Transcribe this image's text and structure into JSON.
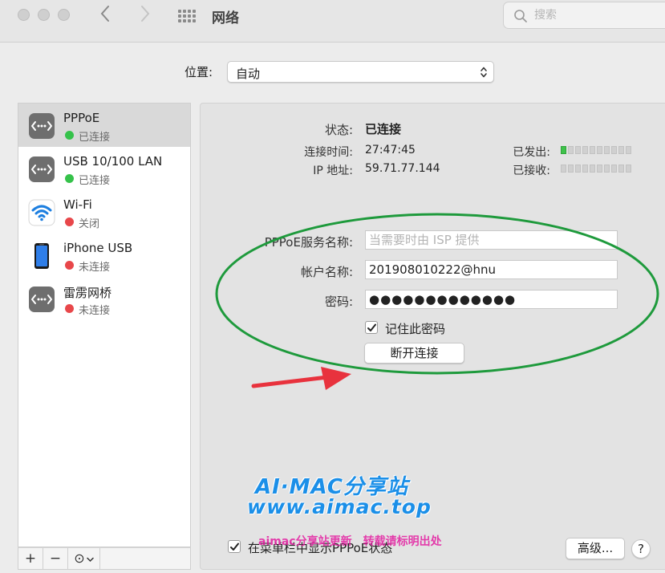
{
  "window": {
    "title": "网络",
    "search_placeholder": "搜索"
  },
  "location": {
    "label": "位置:",
    "value": "自动"
  },
  "sidebar": {
    "items": [
      {
        "name": "PPPoE",
        "status": "已连接",
        "status_color": "#35c24a",
        "icon": "connection-arrows-icon",
        "selected": true
      },
      {
        "name": "USB 10/100 LAN",
        "status": "已连接",
        "status_color": "#35c24a",
        "icon": "connection-arrows-icon",
        "selected": false
      },
      {
        "name": "Wi-Fi",
        "status": "关闭",
        "status_color": "#e8474a",
        "icon": "wifi-icon",
        "selected": false
      },
      {
        "name": "iPhone USB",
        "status": "未连接",
        "status_color": "#e8474a",
        "icon": "iphone-icon",
        "selected": false
      },
      {
        "name": "雷雳网桥",
        "status": "未连接",
        "status_color": "#e8474a",
        "icon": "connection-arrows-icon",
        "selected": false
      }
    ],
    "footer": {
      "add": "+",
      "remove": "−",
      "action": "⊙"
    }
  },
  "detail": {
    "status_label": "状态:",
    "status_value": "已连接",
    "conn_time_label": "连接时间:",
    "conn_time_value": "27:47:45",
    "ip_label": "IP 地址:",
    "ip_value": "59.71.77.144",
    "sent_label": "已发出:",
    "received_label": "已接收:",
    "service_name_label": "PPPoE服务名称:",
    "service_name_placeholder": "当需要时由 ISP 提供",
    "account_label": "帐户名称:",
    "account_value": "201908010222@hnu",
    "password_label": "密码:",
    "password_value": "●●●●●●●●●●●●●",
    "remember_label": "记住此密码",
    "disconnect_button": "断开连接",
    "menubar_status_label": "在菜单栏中显示PPPoE状态",
    "advanced_button": "高级...",
    "help_button": "?"
  },
  "annotation": {
    "ellipse_color": "#1e9a3c",
    "arrow_color": "#e8323d"
  },
  "watermark": {
    "line1": "AI·MAC分享站",
    "line2": "www.aimac.top",
    "line3": "aimac分享站更新　转载请标明出处"
  }
}
